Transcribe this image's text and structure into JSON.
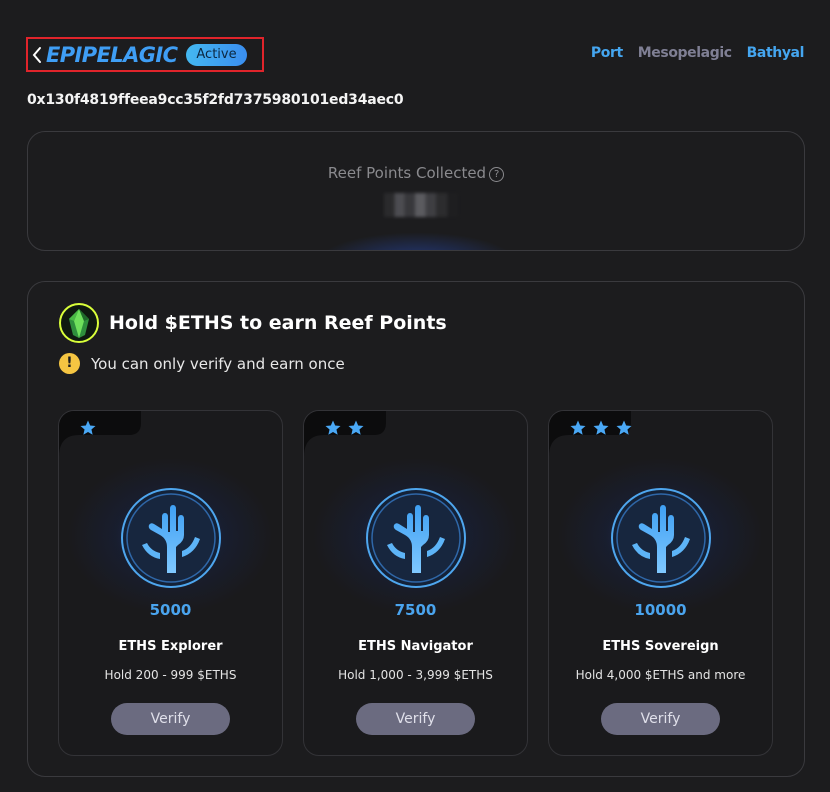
{
  "header": {
    "title": "EPIPELAGIC",
    "status_badge": "Active",
    "nav": [
      "Port",
      "Mesopelagic",
      "Bathyal"
    ]
  },
  "address": "0x130f4819ffeea9cc35f2fd7375980101ed34aec0",
  "points_card": {
    "label": "Reef Points Collected",
    "help_icon": "question-circle-icon"
  },
  "hold": {
    "title": "Hold $ETHS to earn Reef Points",
    "warning": "You can only verify and earn once",
    "tiers": [
      {
        "stars": 1,
        "points": "5000",
        "name": "ETHS Explorer",
        "requirement": "Hold 200 - 999 $ETHS",
        "button": "Verify"
      },
      {
        "stars": 2,
        "points": "7500",
        "name": "ETHS Navigator",
        "requirement": "Hold 1,000 - 3,999 $ETHS",
        "button": "Verify"
      },
      {
        "stars": 3,
        "points": "10000",
        "name": "ETHS Sovereign",
        "requirement": "Hold 4,000 $ETHS and more",
        "button": "Verify"
      }
    ]
  },
  "colors": {
    "accent": "#3f9ef5",
    "highlight_border": "#e0242b",
    "warning": "#f5c542",
    "button": "#6b6b80"
  }
}
